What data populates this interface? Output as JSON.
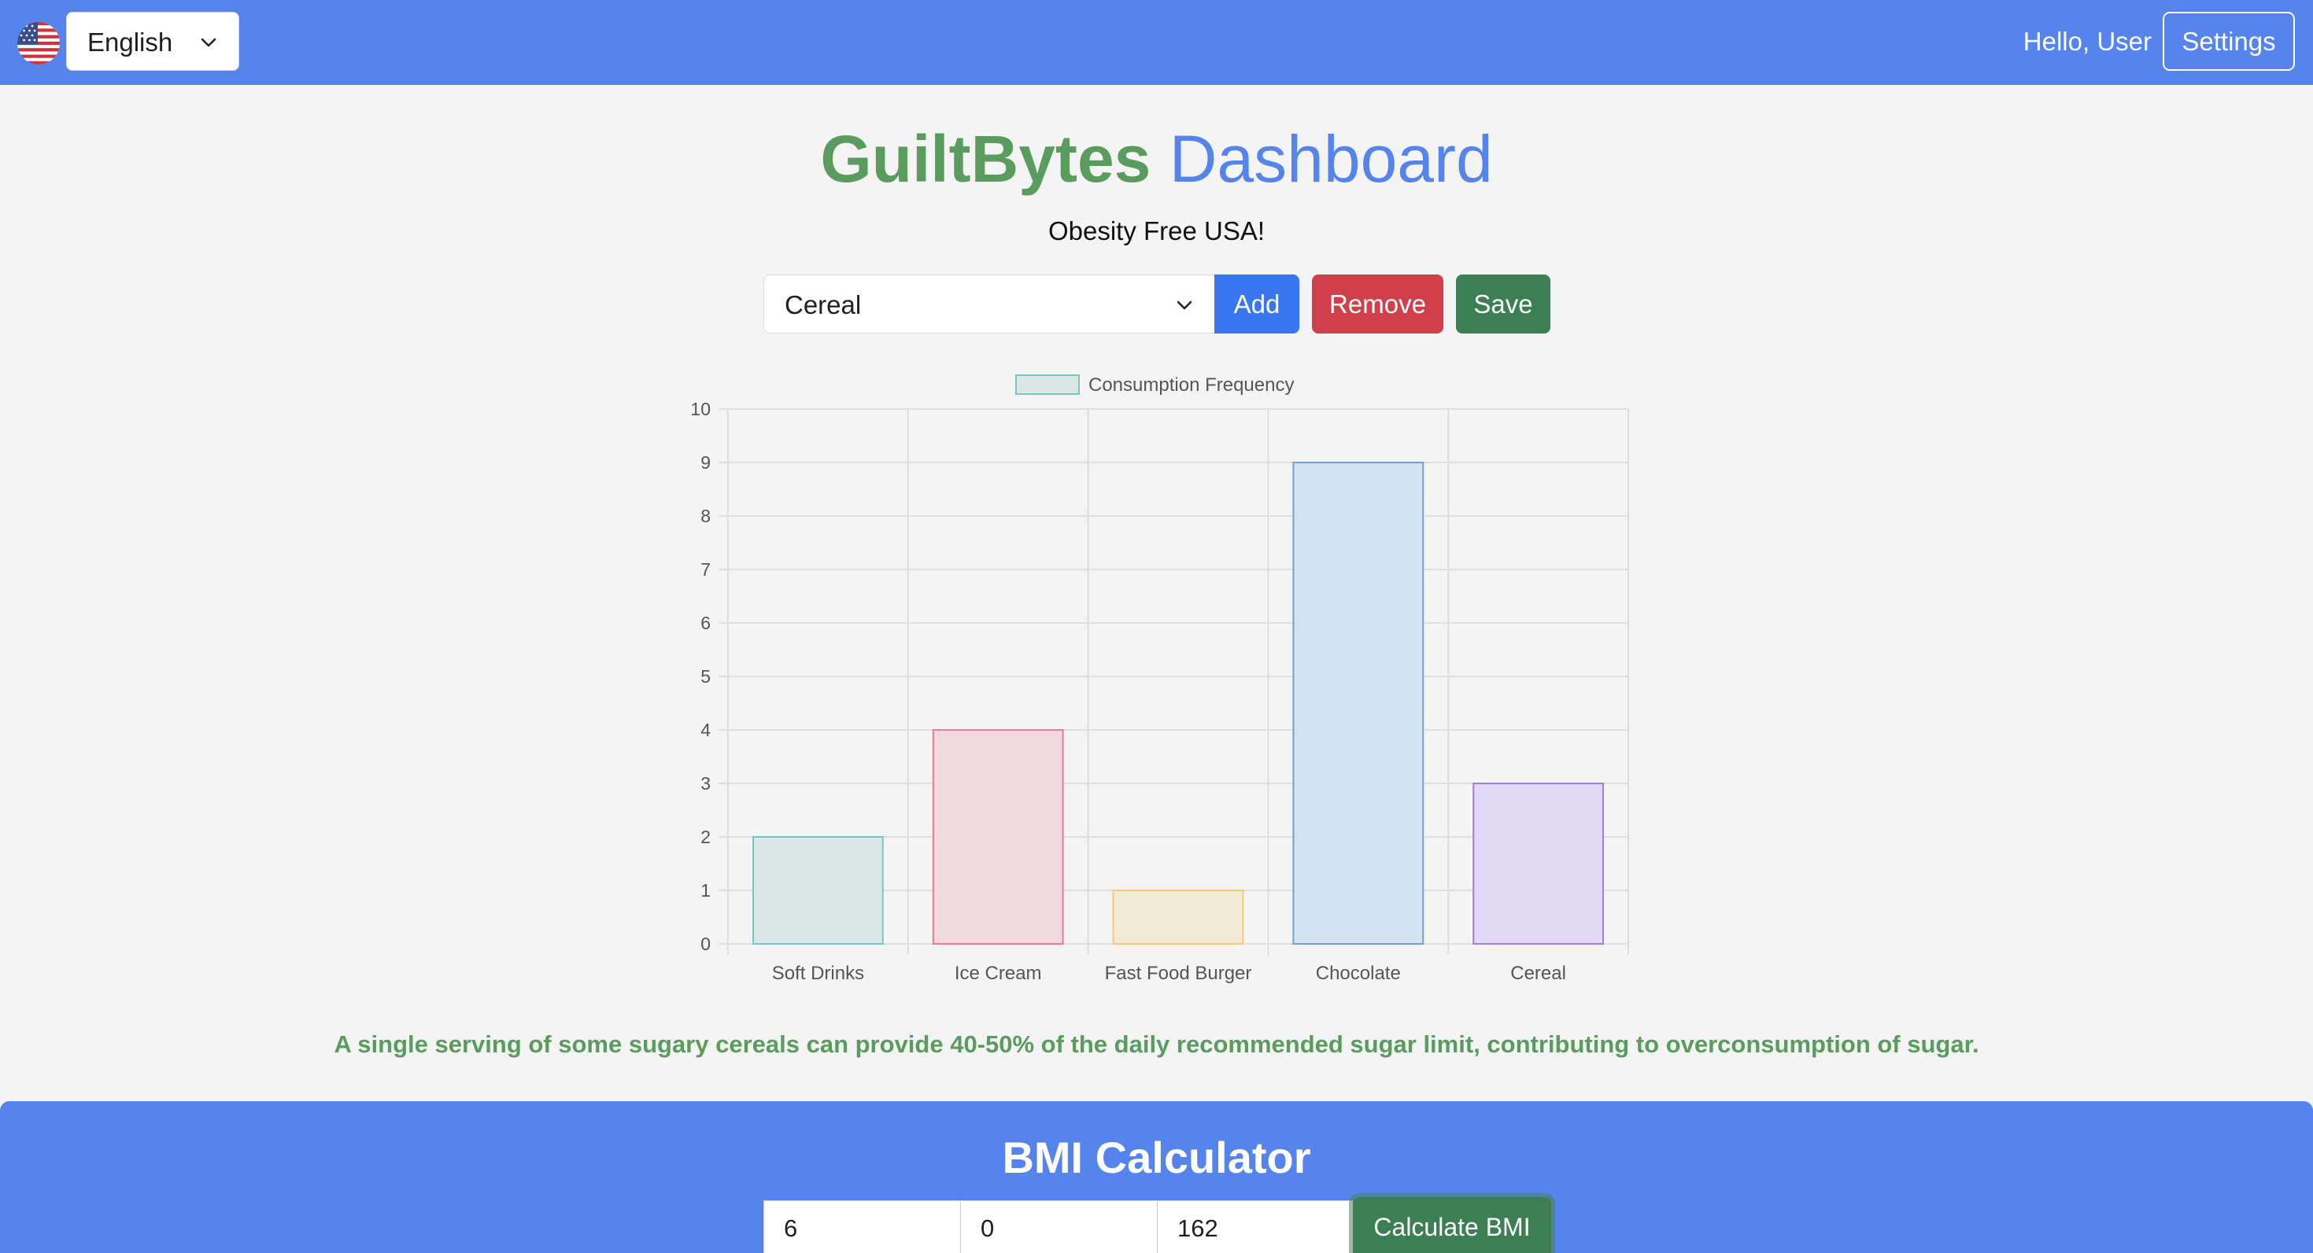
{
  "navbar": {
    "flag_icon": "us-flag-icon",
    "language": "English",
    "greeting": "Hello, User",
    "settings_label": "Settings"
  },
  "header": {
    "title_part1": "GuiltBytes",
    "title_part2": "Dashboard",
    "subtitle": "Obesity Free USA!"
  },
  "controls": {
    "food_selected": "Cereal",
    "add_label": "Add",
    "remove_label": "Remove",
    "save_label": "Save"
  },
  "chart_data": {
    "type": "bar",
    "categories": [
      "Soft Drinks",
      "Ice Cream",
      "Fast Food Burger",
      "Chocolate",
      "Cereal"
    ],
    "series": [
      {
        "name": "Consumption Frequency",
        "values": [
          2,
          4,
          1,
          9,
          3
        ]
      }
    ],
    "bar_fill_colors": [
      "#d9e8e7",
      "#f2d9df",
      "#f4ebd7",
      "#d5e2f1",
      "#e2d9f6"
    ],
    "bar_border_colors": [
      "#7bc4be",
      "#e8799a",
      "#f0cb76",
      "#6aa4db",
      "#9d7ee6"
    ],
    "ylim": [
      0,
      10
    ],
    "yticks": [
      0,
      1,
      2,
      3,
      4,
      5,
      6,
      7,
      8,
      9,
      10
    ],
    "grid": true,
    "legend_position": "top"
  },
  "fact": "A single serving of some sugary cereals can provide 40-50% of the daily recommended sugar limit, contributing to overconsumption of sugar.",
  "bmi": {
    "title": "BMI Calculator",
    "feet": "6",
    "inches": "0",
    "weight": "162",
    "button_label": "Calculate BMI"
  },
  "colors": {
    "primary": "#5484ec",
    "green": "#5a9b5e",
    "add": "#3a76f0",
    "remove": "#d1404a",
    "save": "#3d7f55"
  }
}
